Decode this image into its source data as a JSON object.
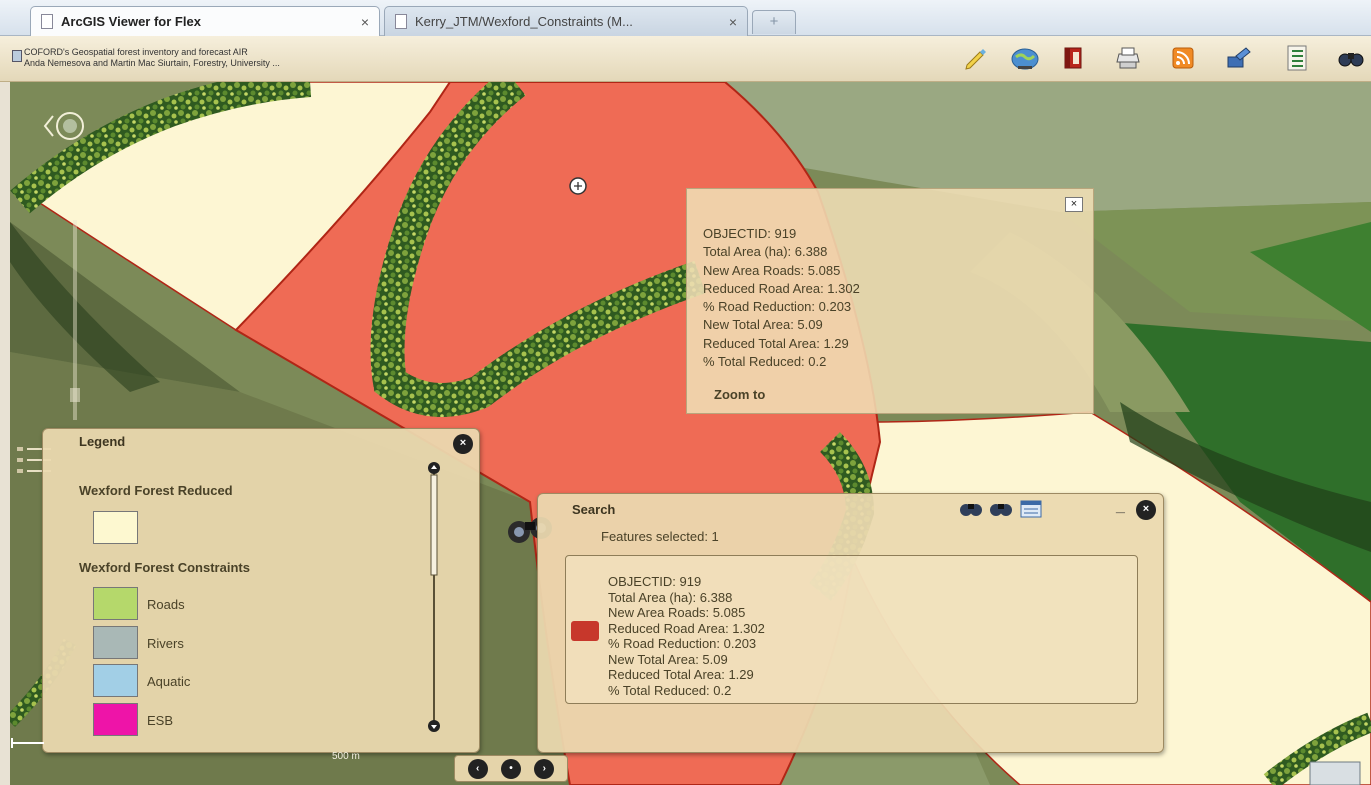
{
  "browser": {
    "tabs": [
      {
        "label": "ArcGIS Viewer for Flex",
        "active": true,
        "close": "×"
      },
      {
        "label": "Kerry_JTM/Wexford_Constraints (M...",
        "active": false,
        "close": "×"
      }
    ],
    "new_tab": "+"
  },
  "header": {
    "line1": "COFORD's Geospatial forest inventory and forecast AIR",
    "line2": "Anda Nemesova and Martin Mac Siurtain, Forestry, University ...",
    "tools": [
      "edit-icon",
      "globe-icon",
      "bookmark-icon",
      "print-icon",
      "rss-icon",
      "draw-icon",
      "layer-list-icon",
      "search-icon"
    ]
  },
  "popup": {
    "close": "×",
    "lines": [
      "OBJECTID: 919",
      "Total Area (ha): 6.388",
      "New Area Roads: 5.085",
      "Reduced  Road Area: 1.302",
      "% Road Reduction: 0.203",
      "New Total Area: 5.09",
      "Reduced  Total Area: 1.29",
      "% Total Reduced: 0.2"
    ],
    "zoom_to": "Zoom to"
  },
  "legend": {
    "title": "Legend",
    "close": "×",
    "groups": [
      {
        "name": "Wexford Forest Reduced",
        "items": [
          {
            "label": "",
            "color": "#fdf8d0"
          }
        ]
      },
      {
        "name": "Wexford Forest Constraints",
        "items": [
          {
            "label": "Roads",
            "color": "#b5d86b"
          },
          {
            "label": "Rivers",
            "color": "#a9b8b6"
          },
          {
            "label": "Aquatic",
            "color": "#a2cfe6"
          },
          {
            "label": "ESB",
            "color": "#ee14a8"
          }
        ]
      }
    ]
  },
  "search": {
    "title": "Search",
    "status": "Features selected: 1",
    "minimize": "_",
    "close": "×",
    "result": {
      "swatch_color": "#c7372b",
      "lines": [
        "OBJECTID: 919",
        "Total Area (ha): 6.388",
        "New Area Roads: 5.085",
        "Reduced  Road Area: 1.302",
        "% Road Reduction: 0.203",
        "New Total Area: 5.09",
        "Reduced  Total Area: 1.29",
        "% Total Reduced: 0.2"
      ]
    }
  },
  "scale": {
    "text": "500 m"
  },
  "colors": {
    "selected_polygon": "#ef6b55",
    "reduced_forest": "#fdf6d3",
    "polygon_outline": "#b02616",
    "panel": "#ebd9af"
  }
}
